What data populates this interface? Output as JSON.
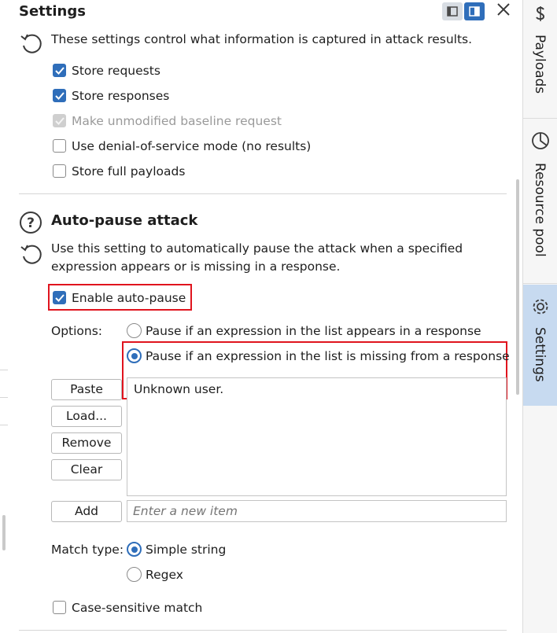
{
  "header": {
    "title": "Settings"
  },
  "results": {
    "description": "These settings control what information is captured in attack results.",
    "options": [
      {
        "label": "Store requests",
        "checked": true,
        "disabled": false
      },
      {
        "label": "Store responses",
        "checked": true,
        "disabled": false
      },
      {
        "label": "Make unmodified baseline request",
        "checked": true,
        "disabled": true
      },
      {
        "label": "Use denial-of-service mode (no results)",
        "checked": false,
        "disabled": false
      },
      {
        "label": "Store full payloads",
        "checked": false,
        "disabled": false
      }
    ]
  },
  "autopause": {
    "heading": "Auto-pause attack",
    "description_line1": "Use this setting to automatically pause the attack when a specified",
    "description_line2": "expression appears or is missing in a response.",
    "enable_label": "Enable auto-pause",
    "enabled": true,
    "options_label": "Options:",
    "radio_appears": "Pause if an expression in the list appears in a response",
    "radio_missing": "Pause if an expression in the list is missing from a response",
    "selected_option": "missing",
    "buttons": {
      "paste": "Paste",
      "load": "Load...",
      "remove": "Remove",
      "clear": "Clear",
      "add": "Add"
    },
    "list_items": [
      "Unknown user."
    ],
    "new_item_placeholder": "Enter a new item",
    "match_type_label": "Match type:",
    "match_simple": "Simple string",
    "match_regex": "Regex",
    "match_selected": "simple",
    "case_sensitive_label": "Case-sensitive match",
    "case_sensitive": false
  },
  "sidebar": {
    "tabs": [
      {
        "label": "Payloads",
        "icon": "dollar-icon",
        "active": false
      },
      {
        "label": "Resource pool",
        "icon": "pie-chart-icon",
        "active": false
      },
      {
        "label": "Settings",
        "icon": "gear-icon",
        "active": true
      }
    ]
  },
  "colors": {
    "accent": "#2f6eba",
    "highlight": "#e0141e",
    "active_tab": "#c7daf0"
  }
}
